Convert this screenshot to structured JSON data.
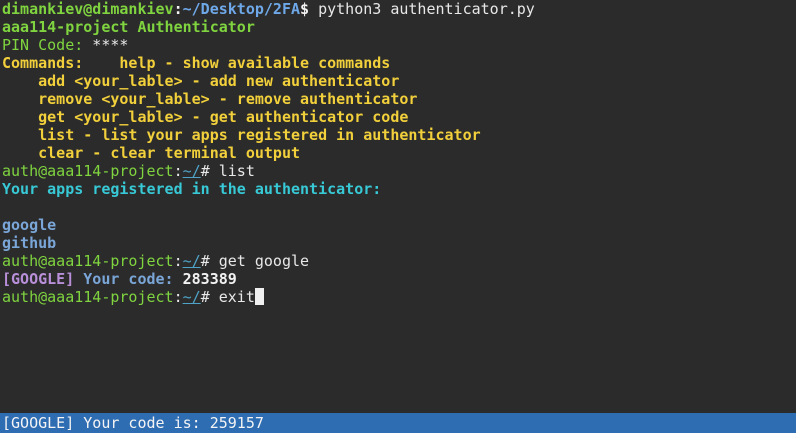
{
  "shell": {
    "user_host": "dimankiev@dimankiev",
    "sep": ":",
    "path": "~/Desktop/2FA",
    "dollar": "$",
    "command": " python3 authenticator.py"
  },
  "app": {
    "title": "aaa114-project Authenticator",
    "pin_label": "PIN Code:",
    "pin_value": " ****"
  },
  "commands": {
    "header": "Commands:",
    "help": "    help - show available commands",
    "add": "    add <your_lable> - add new authenticator",
    "remove": "    remove <your_lable> - remove authenticator",
    "get": "    get <your_lable> - get authenticator code",
    "list": "    list - list your apps registered in authenticator",
    "clear": "    clear - clear terminal output"
  },
  "prompt": {
    "user_host": "auth@aaa114-project",
    "sep": ":",
    "path": "~/",
    "hash": "# "
  },
  "session": {
    "cmd1": "list",
    "apps_heading": "Your apps registered in the authenticator:",
    "apps": [
      "google",
      "github"
    ],
    "cmd2": "get google",
    "code_tag": "[GOOGLE]",
    "code_label": " Your code:",
    "code_value": " 283389",
    "cmd3": "exit"
  },
  "status_bar": {
    "text": "[GOOGLE] Your code is: 259157"
  },
  "colors": {
    "background": "#2b2b2b",
    "status_bar": "#2f6db3",
    "prompt_green": "#7fd43f",
    "commands_yellow": "#f2d03b",
    "heading_cyan": "#38c9d6"
  }
}
